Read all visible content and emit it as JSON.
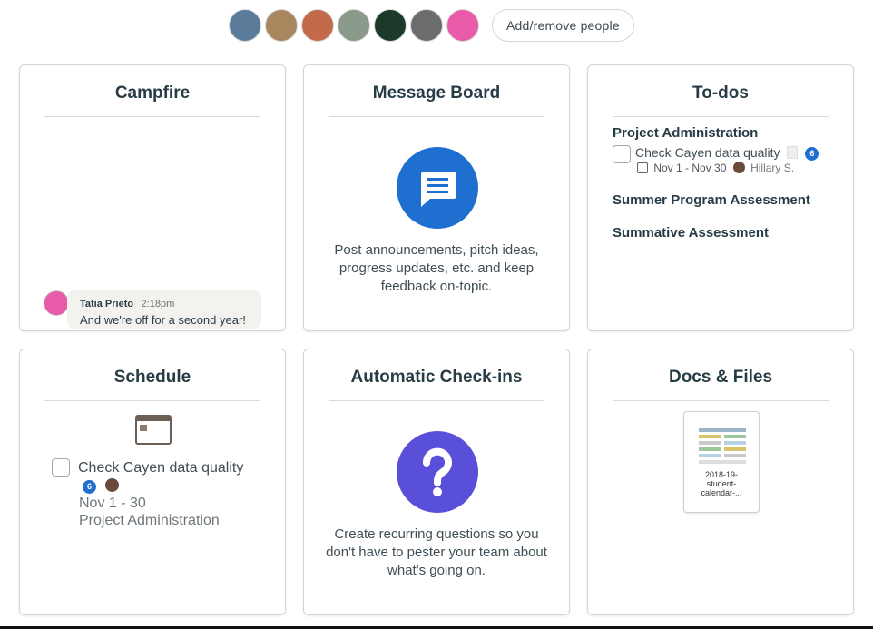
{
  "people": {
    "avatars": [
      {
        "name": "person-1",
        "color": "#5a7c9a"
      },
      {
        "name": "person-2",
        "color": "#a8865e"
      },
      {
        "name": "person-3",
        "color": "#c26a4a"
      },
      {
        "name": "person-4",
        "color": "#8a9a8a"
      },
      {
        "name": "person-5",
        "color": "#1c3a2a"
      },
      {
        "name": "person-6",
        "color": "#6c6c6c"
      },
      {
        "name": "person-7",
        "color": "#e95aa8"
      }
    ],
    "add_label": "Add/remove people"
  },
  "campfire": {
    "title": "Campfire",
    "message": {
      "author": "Tatia Prieto",
      "time": "2:18pm",
      "text": "And we're off for a second year!"
    }
  },
  "message_board": {
    "title": "Message Board",
    "icon": "message-board-icon",
    "icon_color": "#1f6fd0",
    "description": "Post announcements, pitch ideas, progress updates, etc. and keep feedback on-topic."
  },
  "todos": {
    "title": "To-dos",
    "groups": [
      {
        "name": "Project Administration",
        "items": [
          {
            "text": "Check Cayen data quality",
            "count": "6",
            "dates": "Nov 1 - Nov 30",
            "assignee": "Hillary S."
          }
        ]
      },
      {
        "name": "Summer Program Assessment"
      },
      {
        "name": "Summative Assessment"
      }
    ]
  },
  "schedule": {
    "title": "Schedule",
    "event": {
      "text": "Check Cayen data quality",
      "count": "6",
      "dates": "Nov 1 - 30",
      "project": "Project Administration"
    }
  },
  "checkins": {
    "title": "Automatic Check-ins",
    "icon": "question-icon",
    "icon_color": "#5a4fd8",
    "description": "Create recurring questions so you don't have to pester your team about what's going on."
  },
  "docs": {
    "title": "Docs & Files",
    "file_name": "2018-19-student-calendar-..."
  }
}
